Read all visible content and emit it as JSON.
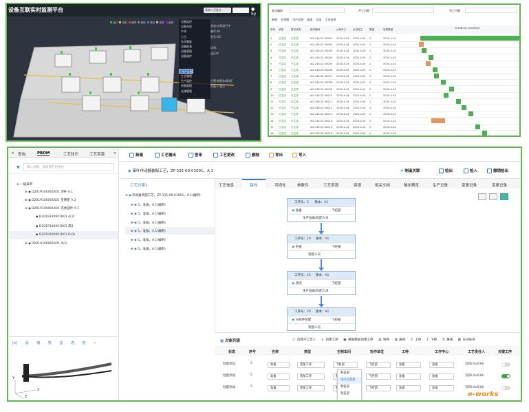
{
  "top_left": {
    "title": "设备互联实时监测平台",
    "search_placeholder": "请输入设备名",
    "user_label": "Sy",
    "legend": [
      "运行",
      "待机",
      "故障",
      "离线",
      "调试",
      "关机",
      "维修"
    ],
    "menu_items": [
      "设备监控",
      "设备台账",
      "产线",
      "工位",
      "车间看板",
      "设备报表",
      "设备管理",
      "设备维护",
      "",
      "",
      "生产计划",
      "",
      "工艺管理",
      "生产监控",
      "质量管理",
      "仓储管理"
    ],
    "menu_selected_index": 10,
    "menu2": [
      "状态:在线运行中",
      "编号:A1",
      "型号:XX",
      "",
      "功率:",
      "运行中",
      "",
      "",
      "",
      "",
      "位置:装配车间A区",
      "负责人:张三",
      "",
      ""
    ]
  },
  "top_right": {
    "filters": [
      "批次编码",
      "开工日期",
      "完工日期"
    ],
    "actions": [
      "新增",
      "甘特图",
      "生产信息",
      "修改",
      "导出",
      "工艺信息"
    ],
    "headers": [
      "序号",
      "状态",
      "批次状态",
      "批次编号",
      "计划开工",
      "计划完工",
      "数量",
      "完成数量"
    ],
    "timeline_header": "2020年1月-2020年2月",
    "rows": [
      [
        "1",
        "已生成",
        "已生成",
        "AG-C46-S2-00001",
        "2020-4-24",
        "2020-4-24",
        "2",
        "2020-4-24"
      ],
      [
        "2",
        "已生成",
        "已生成",
        "AG-C46-S2-00002",
        "2020-4-24",
        "2020-4-24",
        "2",
        "2020-4-24"
      ],
      [
        "3",
        "已生成",
        "已生成",
        "AG-C46-S2-00003",
        "2020-4-24",
        "2020-4-24",
        "2",
        "2020-4-24"
      ],
      [
        "4",
        "已生成",
        "已生成",
        "AG-C46-S2-00004",
        "2020-4-24",
        "2020-4-24",
        "2",
        "2020-4-24"
      ],
      [
        "5",
        "已生成",
        "已生成",
        "AG-C46-S2-00005",
        "2020-4-24",
        "2020-4-24",
        "2",
        "2020-4-24"
      ],
      [
        "6",
        "已生成",
        "已生成",
        "AG-C46-S2-00006",
        "2020-4-24",
        "2020-4-24",
        "2",
        "2020-4-24"
      ],
      [
        "7",
        "已生成",
        "已生成",
        "AG-C46-S2-00007",
        "2020-4-24",
        "2020-4-24",
        "2",
        "2020-4-24"
      ],
      [
        "8",
        "已生成",
        "已生成",
        "AG-C46-S2-00008",
        "2020-4-24",
        "2020-4-24",
        "2",
        "2020-4-24"
      ],
      [
        "9",
        "已生成",
        "已生成",
        "AG-C46-S2-00009",
        "2020-4-24",
        "2020-4-24",
        "2",
        "2020-4-24"
      ],
      [
        "10",
        "已生成",
        "已生成",
        "AG-C46-S2-00010",
        "2020-4-24",
        "2020-4-24",
        "2",
        "2020-4-24"
      ],
      [
        "11",
        "已生成",
        "已生成",
        "AG-C46-S2-00011",
        "2020-4-24",
        "2020-4-24",
        "2",
        "2020-4-24"
      ],
      [
        "12",
        "已生成",
        "已生成",
        "AG-C46-S2-00012",
        "2020-4-24",
        "2020-4-24",
        "2",
        "2020-4-24"
      ],
      [
        "13",
        "已生成",
        "已生成",
        "AG-C46-S2-00013",
        "2020-4-24",
        "2020-4-24",
        "2",
        "2020-4-24"
      ],
      [
        "14",
        "已生成",
        "已生成",
        "AG-C46-S2-00014",
        "2020-4-24",
        "2020-4-24",
        "2",
        "2020-4-24"
      ],
      [
        "15",
        "已生成",
        "已生成",
        "AG-C46-S2-00015",
        "2020-4-24",
        "2020-4-24",
        "2",
        "2020-4-24"
      ],
      [
        "16",
        "已生成",
        "已生成",
        "AG-C46-S2-00016",
        "2020-4-24",
        "2020-4-24",
        "2",
        "2020-4-24"
      ]
    ]
  },
  "left_panel": {
    "tabs": [
      "查询",
      "PBOM",
      "工艺知识",
      "工艺资源"
    ],
    "search_placeholder": "输入关键、搜索或在树查找",
    "tree": [
      "一级菜单",
      "D2019100001K01 顶杆 A.1",
      "D2019100001K01 支撑座 A.1",
      "D2019100001K01 壳体部件 A.1",
      "D2019100001K01 A(2)",
      "D2019100001K01 隔3",
      "D2019100001K01 D(3)",
      "D2019100001K01 A(3)"
    ],
    "toolbar3d": [
      "[o]",
      "适",
      "缩",
      "视",
      "显",
      "选",
      "剖",
      "»"
    ],
    "axis": [
      "Y",
      "X",
      "Z"
    ]
  },
  "main": {
    "toolbar": [
      "新建",
      "工艺输出",
      "签审",
      "工艺更改",
      "删除",
      "导出",
      "导入"
    ],
    "doc_title": "牵叶作动器装配工艺，ZP-335-00-01001，A.1",
    "right_actions": [
      "制造关联",
      "检出",
      "检入",
      "撤销检出"
    ],
    "plan_tab": "工艺方案1",
    "content_tabs": [
      "工艺信息",
      "路线",
      "可视化",
      "参数件",
      "工艺资源",
      "资源",
      "相关文档",
      "输出预览",
      "生产记录",
      "变更记录",
      "变更记录"
    ],
    "active_tab_index": 1,
    "plan_tree": [
      "作动器装配工艺，ZP-335-00-01001，A.1(编制)",
      "5，准备，A.1(编制)",
      "5，准备，A.1(编制)",
      "5，准备，A.1(编制)",
      "5，准备，A.1(编制)",
      "5，准备，A.1(编制)",
      "5，准备，A.1(编制)"
    ],
    "flow_nodes": [
      {
        "step": "工序号：5",
        "version": "版本：A1",
        "name": "准备",
        "dept": "飞控部",
        "role": "生产准备/装配人员"
      },
      {
        "step": "工序号：10",
        "version": "版本：A1",
        "name": "检查",
        "dept": "飞控部",
        "role": "装配人员"
      },
      {
        "step": "工序号：15",
        "version": "版本：A1",
        "name": "清洗",
        "dept": "飞控部",
        "role": "生产准备/装配人员"
      },
      {
        "step": "工序号：20",
        "version": "版本：A1",
        "name": "分组件装配",
        "dept": "飞控部",
        "role": "装配人员"
      }
    ],
    "object_list": {
      "title": "对象列表",
      "actions": [
        "创建子工艺人",
        "创建工序",
        "根据模板创建工序",
        "保存",
        "删除",
        "上移",
        "下移",
        "重排",
        "分派任务"
      ],
      "headers": [
        "状态",
        "序号",
        "名称",
        "类型",
        "主制车间",
        "协作单位",
        "工种",
        "工作中心",
        "工艺责任人",
        "关键工序"
      ],
      "rows": [
        {
          "status": "批量添加",
          "no": "5",
          "name": "准备",
          "type": "装配工序",
          "workshop": "飞机部",
          "coop": "飞控部",
          "craft": "准备",
          "center": "准备",
          "owner": "刘四(sfu038)",
          "key": false
        },
        {
          "status": "批量添加",
          "no": "5",
          "name": "准备",
          "type": "装配工序",
          "workshop": "制造部",
          "coop": "飞控部",
          "craft": "准备",
          "center": "准备",
          "owner": "刘四(sfu038)",
          "key": true
        },
        {
          "status": "批量添加",
          "no": "5",
          "name": "准备",
          "type": "装配工序",
          "workshop": "制造部",
          "coop": "飞控部",
          "craft": "准备",
          "center": "准备",
          "owner": "刘四(sfu038)",
          "key": false
        }
      ],
      "dropdown": [
        "制造部",
        "电子信息部",
        "制造部",
        "制造部"
      ],
      "dropdown_highlight": 1
    },
    "watermark": "e-works"
  }
}
